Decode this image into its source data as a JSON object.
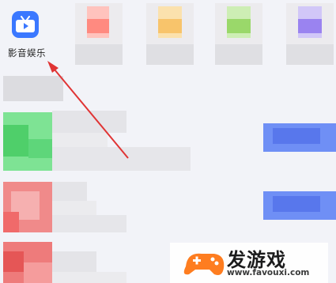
{
  "app": {
    "label": "影音娱乐",
    "icon": "tv-play-icon",
    "accent": "#3b78ff"
  },
  "colors": {
    "icon_red": "#ff8a80",
    "icon_yellow": "#f8c46b",
    "icon_green": "#9ad86a",
    "icon_purple": "#9a83f0",
    "tile_green": "#5ed67a",
    "tile_red": "#f06a6a",
    "tile_red2": "#e55656",
    "button_blue": "#6f8ff5",
    "arrow_red": "#e03434",
    "watermark_orange": "#ff7a1a"
  },
  "watermark": {
    "title": "发游戏",
    "url": "www.favouxi.com"
  }
}
